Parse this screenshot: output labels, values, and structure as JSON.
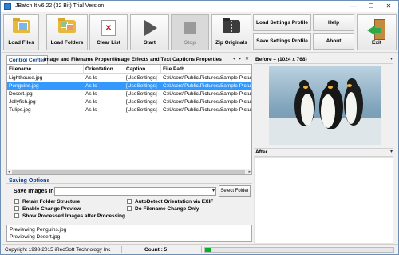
{
  "window": {
    "title": "JBatch It v6.22 (32 Bit) Trial Version",
    "controls": {
      "minimize": "—",
      "maximize": "☐",
      "close": "✕"
    }
  },
  "toolbar": {
    "load_files": "Load Files",
    "load_folders": "Load Folders",
    "clear_list": "Clear List",
    "start": "Start",
    "stop": "Stop",
    "zip_originals": "Zip Originals",
    "load_settings_profile": "Load Settings Profile",
    "save_settings_profile": "Save Settings Profile",
    "help": "Help",
    "about": "About",
    "exit": "Exit"
  },
  "tabs": {
    "items": [
      "Control Center",
      "Image and Filename Properties",
      "Image Effects and Text Captions Properties"
    ],
    "active_index": 0,
    "scroll_left": "◂",
    "scroll_right": "▸",
    "close": "✕"
  },
  "file_table": {
    "columns": [
      "Filename",
      "Orientation",
      "Caption",
      "File Path"
    ],
    "rows": [
      {
        "filename": "Lighthouse.jpg",
        "orientation": "As Is",
        "caption": "[UseSettings]",
        "path": "C:\\Users\\Public\\Pictures\\Sample Pictures\\"
      },
      {
        "filename": "Penguins.jpg",
        "orientation": "As Is",
        "caption": "[UseSettings]",
        "path": "C:\\Users\\Public\\Pictures\\Sample Pictures\\"
      },
      {
        "filename": "Desert.jpg",
        "orientation": "As Is",
        "caption": "[UseSettings]",
        "path": "C:\\Users\\Public\\Pictures\\Sample Pictures\\"
      },
      {
        "filename": "Jellyfish.jpg",
        "orientation": "As Is",
        "caption": "[UseSettings]",
        "path": "C:\\Users\\Public\\Pictures\\Sample Pictures\\"
      },
      {
        "filename": "Tulips.jpg",
        "orientation": "As Is",
        "caption": "[UseSettings]",
        "path": "C:\\Users\\Public\\Pictures\\Sample Pictures\\"
      }
    ],
    "selected_index": 1,
    "scroll_left": "◂",
    "scroll_right": "▸"
  },
  "saving_options": {
    "heading": "Saving Options",
    "save_images_in_label": "Save Images In",
    "save_images_in_value": "",
    "dropdown_arrow": "▾",
    "select_folder_button": "Select Folder",
    "checkboxes": {
      "retain_folder_structure": "Retain Folder Structure",
      "enable_change_preview": "Enable Change Preview",
      "show_processed": "Show Processed Images after Processing",
      "autodetect_orientation": "AutoDetect Orientation via EXIF",
      "do_filename_change_only": "Do Filename Change Only"
    }
  },
  "log": {
    "lines": [
      "Previewing Penguins.jpg",
      "Previewing Desert.jpg"
    ]
  },
  "preview": {
    "before_title": "Before – (1024 x 768)",
    "after_title": "After",
    "dropdown_arrow": "▾"
  },
  "status": {
    "copyright": "Copyright 1998-2015 iRedSoft Technology Inc",
    "count": "Count : 5",
    "progress": 0.03
  },
  "colors": {
    "selection": "#3399ff",
    "accent_text": "#0b3f8a",
    "progress": "#06b025"
  }
}
